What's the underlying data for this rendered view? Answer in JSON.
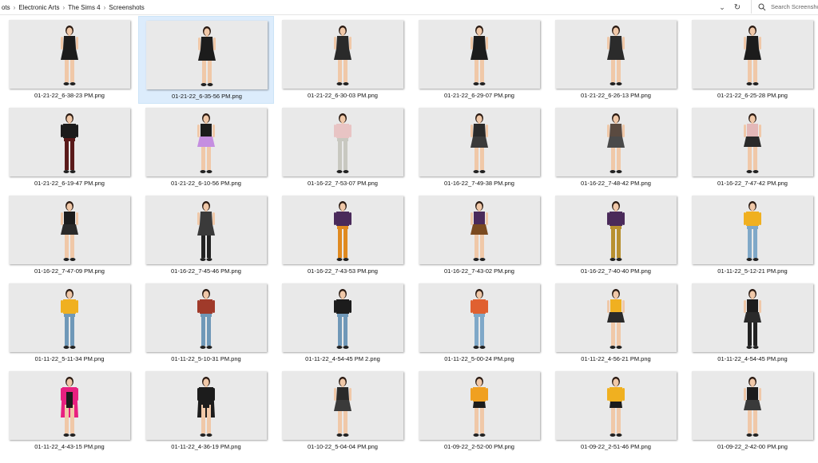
{
  "breadcrumb": [
    "ots",
    "Electronic Arts",
    "The Sims 4",
    "Screenshots"
  ],
  "search": {
    "placeholder": "Search Screenshots"
  },
  "files": [
    {
      "name": "01-21-22_6-38-23 PM.png",
      "outfit": {
        "top": "#1c1c1c",
        "bottom": "#1c1c1c",
        "legs": "skin",
        "style": "dress"
      }
    },
    {
      "name": "01-21-22_6-35-56 PM.png",
      "outfit": {
        "top": "#1c1c1c",
        "bottom": "#1c1c1c",
        "legs": "skin",
        "style": "dress"
      },
      "selected": true
    },
    {
      "name": "01-21-22_6-30-03 PM.png",
      "outfit": {
        "top": "#2a2a2a",
        "bottom": "#2a2a2a",
        "legs": "skin",
        "style": "dress"
      }
    },
    {
      "name": "01-21-22_6-29-07 PM.png",
      "outfit": {
        "top": "#1c1c1c",
        "bottom": "#1c1c1c",
        "legs": "skin",
        "style": "dress"
      }
    },
    {
      "name": "01-21-22_6-26-13 PM.png",
      "outfit": {
        "top": "#2b2b2b",
        "bottom": "#2b2b2b",
        "legs": "skin",
        "style": "dress"
      }
    },
    {
      "name": "01-21-22_6-25-28 PM.png",
      "outfit": {
        "top": "#1c1c1c",
        "bottom": "#1c1c1c",
        "legs": "skin",
        "style": "dress"
      }
    },
    {
      "name": "01-21-22_6-19-47 PM.png",
      "outfit": {
        "top": "#1c1c1c",
        "bottom": "#5a1a1a",
        "legs": "pants",
        "style": "separates"
      }
    },
    {
      "name": "01-21-22_6-10-56 PM.png",
      "outfit": {
        "top": "#1c1c1c",
        "bottom": "#c58ee0",
        "legs": "skin",
        "style": "skirt"
      }
    },
    {
      "name": "01-16-22_7-53-07 PM.png",
      "outfit": {
        "top": "#e8c4c4",
        "bottom": "#c8c8c0",
        "legs": "pants",
        "style": "separates"
      }
    },
    {
      "name": "01-16-22_7-49-38 PM.png",
      "outfit": {
        "top": "#2a2a2a",
        "bottom": "#3a3a3a",
        "legs": "skin",
        "style": "dress"
      }
    },
    {
      "name": "01-16-22_7-48-42 PM.png",
      "outfit": {
        "top": "#5a4a40",
        "bottom": "#4a4a4a",
        "legs": "skin",
        "style": "dress"
      }
    },
    {
      "name": "01-16-22_7-47-42 PM.png",
      "outfit": {
        "top": "#e3b8b8",
        "bottom": "#2a2a2a",
        "legs": "skin",
        "style": "skirt"
      }
    },
    {
      "name": "01-16-22_7-47-09 PM.png",
      "outfit": {
        "top": "#1c1c1c",
        "bottom": "#2a2a2a",
        "legs": "skin",
        "style": "skirt"
      }
    },
    {
      "name": "01-16-22_7-45-46 PM.png",
      "outfit": {
        "top": "#3a3a3a",
        "bottom": "#3a3a3a",
        "legs": "tights",
        "style": "dress"
      }
    },
    {
      "name": "01-16-22_7-43-53 PM.png",
      "outfit": {
        "top": "#4a2a5a",
        "bottom": "#e08a20",
        "legs": "pants",
        "style": "separates"
      }
    },
    {
      "name": "01-16-22_7-43-02 PM.png",
      "outfit": {
        "top": "#4a2a5a",
        "bottom": "#7a4a20",
        "legs": "skin",
        "style": "skirt"
      }
    },
    {
      "name": "01-16-22_7-40-40 PM.png",
      "outfit": {
        "top": "#4a2a5a",
        "bottom": "#b89030",
        "legs": "pants",
        "style": "separates"
      }
    },
    {
      "name": "01-11-22_5-12-21 PM.png",
      "outfit": {
        "top": "#f0b020",
        "bottom": "#7fa8c8",
        "legs": "pants",
        "style": "separates"
      }
    },
    {
      "name": "01-11-22_5-11-34 PM.png",
      "outfit": {
        "top": "#f0b020",
        "bottom": "#6f98b8",
        "legs": "pants",
        "style": "separates"
      }
    },
    {
      "name": "01-11-22_5-10-31 PM.png",
      "outfit": {
        "top": "#a03a2a",
        "bottom": "#6f98b8",
        "legs": "pants",
        "style": "separates"
      }
    },
    {
      "name": "01-11-22_4-54-45 PM 2.png",
      "outfit": {
        "top": "#1c1c1c",
        "bottom": "#6f98b8",
        "legs": "pants",
        "style": "separates"
      }
    },
    {
      "name": "01-11-22_5-00-24 PM.png",
      "outfit": {
        "top": "#e06030",
        "bottom": "#7fa8c8",
        "legs": "pants",
        "style": "separates"
      }
    },
    {
      "name": "01-11-22_4-56-21 PM.png",
      "outfit": {
        "top": "#f0b020",
        "bottom": "#2a2a2a",
        "legs": "skin",
        "style": "skirt"
      }
    },
    {
      "name": "01-11-22_4-54-45 PM.png",
      "outfit": {
        "top": "#1c1c1c",
        "bottom": "#2a2a2a",
        "legs": "tights",
        "style": "skirt"
      }
    },
    {
      "name": "01-11-22_4-43-15 PM.png",
      "outfit": {
        "top": "#e82080",
        "bottom": "#1c1c1c",
        "legs": "skin",
        "style": "coat"
      }
    },
    {
      "name": "01-11-22_4-36-19 PM.png",
      "outfit": {
        "top": "#1c1c1c",
        "bottom": "#1c1c1c",
        "legs": "skin",
        "style": "coat"
      }
    },
    {
      "name": "01-10-22_5-04-04 PM.png",
      "outfit": {
        "top": "#2a2a2a",
        "bottom": "#3a3a3a",
        "legs": "skin",
        "style": "dress"
      }
    },
    {
      "name": "01-09-22_2-52-00 PM.png",
      "outfit": {
        "top": "#f0a020",
        "bottom": "#1c1c1c",
        "legs": "skin",
        "style": "separates"
      }
    },
    {
      "name": "01-09-22_2-51-46 PM.png",
      "outfit": {
        "top": "#f0b020",
        "bottom": "#1c1c1c",
        "legs": "skin",
        "style": "separates"
      }
    },
    {
      "name": "01-09-22_2-42-00 PM.png",
      "outfit": {
        "top": "#1c1c1c",
        "bottom": "#3a3a3a",
        "legs": "skin",
        "style": "skirt"
      }
    }
  ],
  "colors": {
    "selection": "#dcecfc",
    "thumb_bg": "#e9e9e9",
    "skin": "#f0c8a8",
    "hair": "#2a1a12"
  },
  "icons": {
    "dropdown": "chevron-down-icon",
    "refresh": "refresh-icon",
    "search": "search-icon",
    "separator": "chevron-right-icon"
  }
}
